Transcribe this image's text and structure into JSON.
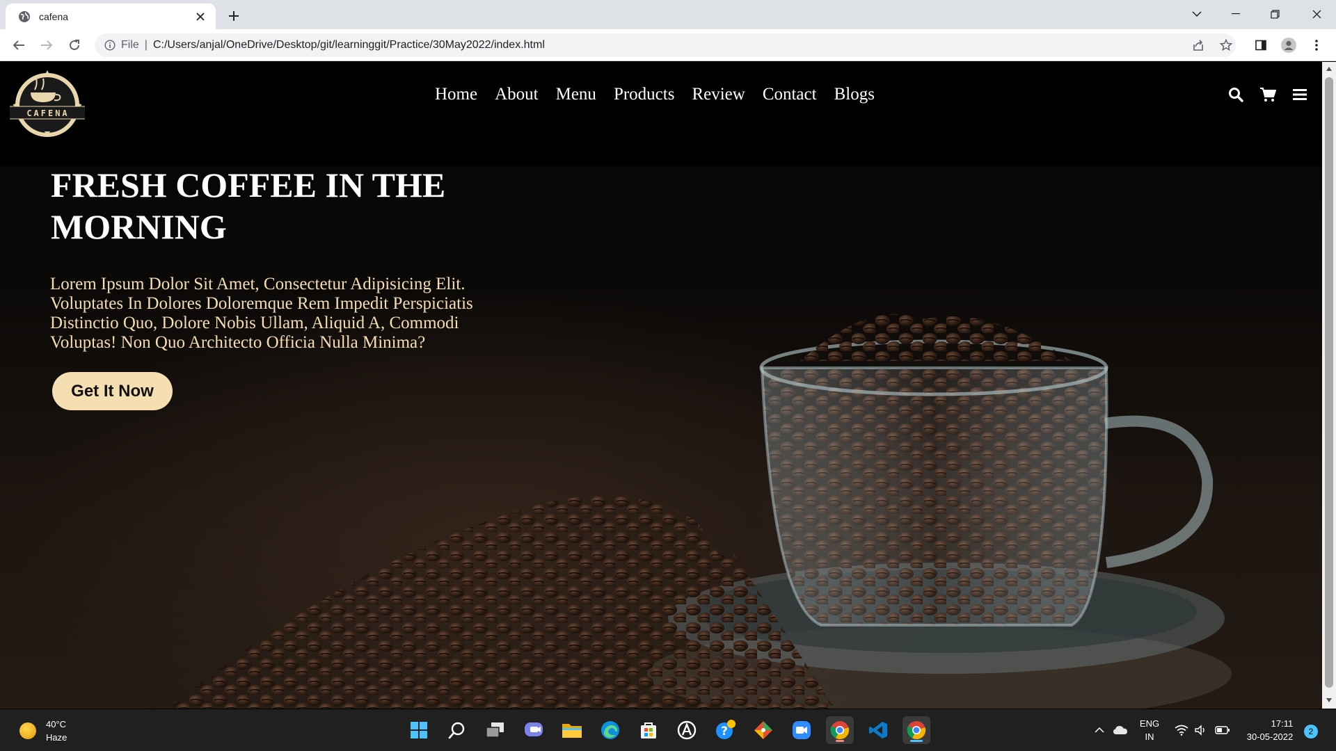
{
  "browser": {
    "tab_title": "cafena",
    "url_protocol": "File",
    "url": "C:/Users/anjal/OneDrive/Desktop/git/learninggit/Practice/30May2022/index.html"
  },
  "site": {
    "logo_text": "CAFENA",
    "nav": [
      "Home",
      "About",
      "Menu",
      "Products",
      "Review",
      "Contact",
      "Blogs"
    ],
    "header_icons": [
      "search-icon",
      "cart-icon",
      "menu-bars-icon"
    ],
    "hero_title": "FRESH COFFEE IN THE MORNING",
    "hero_text": "Lorem Ipsum Dolor Sit Amet, Consectetur Adipisicing Elit. Voluptates In Dolores Doloremque Rem Impedit Perspiciatis Distinctio Quo, Dolore Nobis Ullam, Aliquid A, Commodi Voluptas! Non Quo Architecto Officia Nulla Minima?",
    "cta_label": "Get It Now",
    "accent_color": "#f6deb3"
  },
  "taskbar": {
    "weather_temp": "40°C",
    "weather_desc": "Haze",
    "lang_line1": "ENG",
    "lang_line2": "IN",
    "time": "17:11",
    "date": "30-05-2022",
    "notification_count": "2",
    "apps": [
      "windows-start-icon",
      "search-icon",
      "task-view-icon",
      "teams-chat-icon",
      "file-explorer-icon",
      "edge-icon",
      "store-icon",
      "app-circle-icon",
      "help-icon",
      "git-icon",
      "zoom-icon",
      "chrome-icon",
      "vscode-icon",
      "chrome-active-icon"
    ]
  }
}
